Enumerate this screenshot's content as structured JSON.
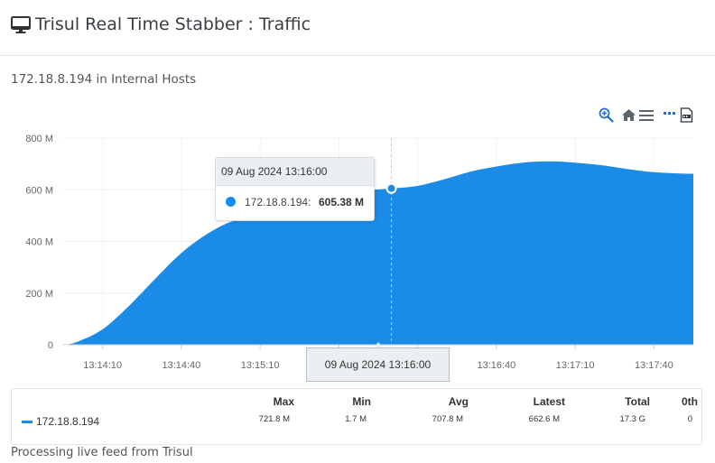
{
  "header": {
    "title": "Trisul Real Time Stabber : Traffic",
    "icon": "monitor-icon"
  },
  "subtitle": "172.18.8.194 in Internal Hosts",
  "toolbar": {
    "icons": [
      "zoom-in-icon",
      "home-icon",
      "menu-icon",
      "more-icon",
      "pdf-icon"
    ]
  },
  "colors": {
    "series": "#1b8be8",
    "accent": "#1e6fd9"
  },
  "tooltip": {
    "header": "09 Aug 2024 13:16:00",
    "series": "172.18.8.194:",
    "value": "605.38 M"
  },
  "crosshair_label": "09 Aug 2024 13:16:00",
  "chart_data": {
    "type": "area",
    "series": [
      {
        "name": "172.18.8.194",
        "x": [
          "13:13:55",
          "13:14:00",
          "13:14:10",
          "13:14:20",
          "13:14:30",
          "13:14:40",
          "13:14:50",
          "13:15:00",
          "13:15:10",
          "13:15:20",
          "13:15:30",
          "13:15:40",
          "13:15:50",
          "13:16:00",
          "13:16:10",
          "13:16:20",
          "13:16:30",
          "13:16:40",
          "13:16:50",
          "13:17:00",
          "13:17:10",
          "13:17:20",
          "13:17:30",
          "13:17:40",
          "13:17:50",
          "13:17:55"
        ],
        "values": [
          0,
          10,
          60,
          150,
          255,
          355,
          430,
          480,
          495,
          500,
          515,
          560,
          595,
          605,
          615,
          640,
          670,
          690,
          705,
          710,
          705,
          695,
          680,
          668,
          663,
          662
        ]
      }
    ],
    "x_ticks": [
      "13:14:10",
      "13:14:40",
      "13:15:10",
      "13:15:40",
      "13:16:10",
      "13:16:40",
      "13:17:10",
      "13:17:40"
    ],
    "y_ticks": [
      "0",
      "200 M",
      "400 M",
      "600 M",
      "800 M"
    ],
    "ylim": [
      0,
      800
    ],
    "y_unit": "M",
    "grid": true,
    "highlight": {
      "x": "13:16:00",
      "value": 605.38
    }
  },
  "legend": {
    "columns": [
      "Max",
      "Min",
      "Avg",
      "Latest",
      "Total",
      "0th"
    ],
    "rows": [
      {
        "name": "172.18.8.194",
        "values": [
          "721.8 M",
          "1.7 M",
          "707.8 M",
          "662.6 M",
          "17.3 G",
          "0"
        ]
      }
    ]
  },
  "status": "Processing live feed from Trisul"
}
